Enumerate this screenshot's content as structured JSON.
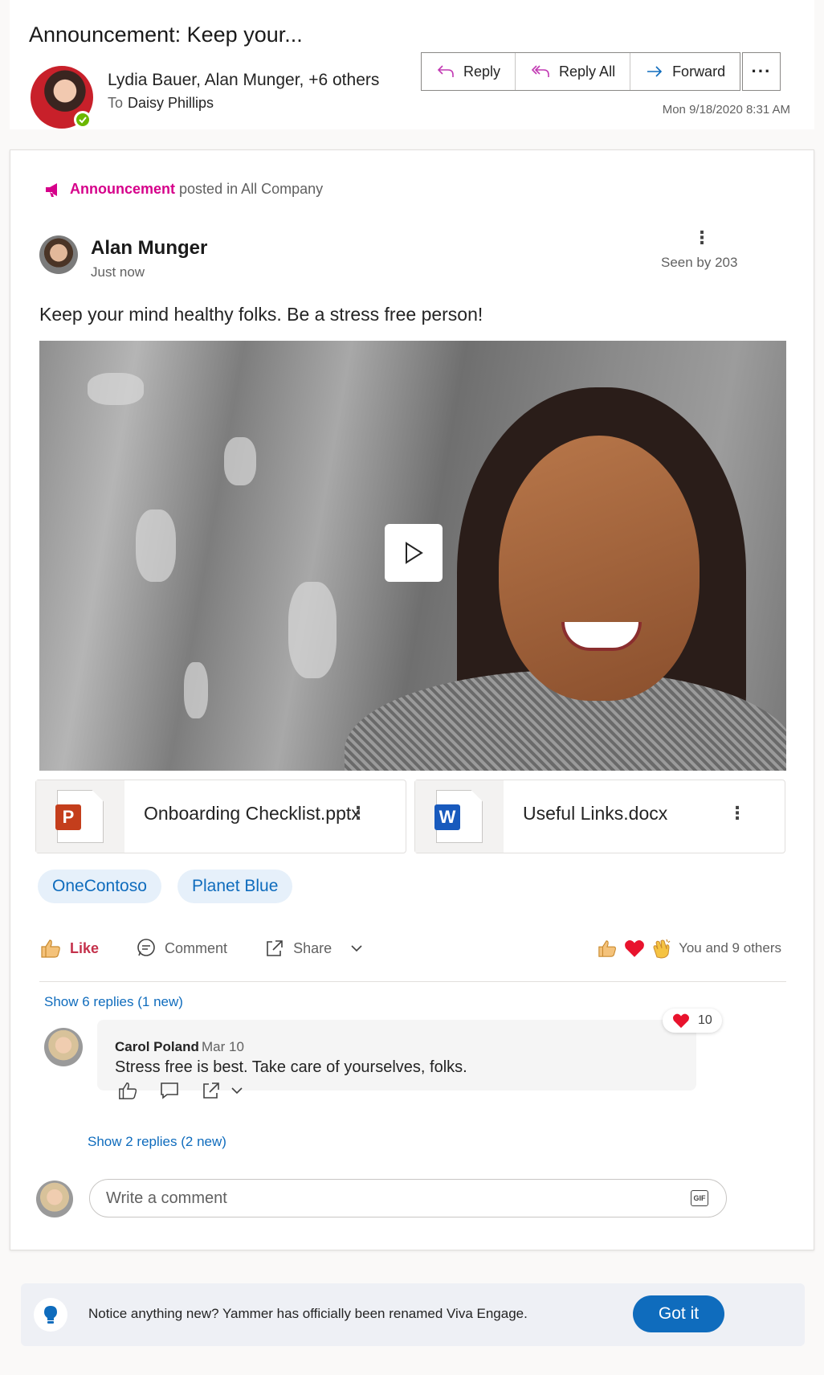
{
  "header": {
    "subject": "Announcement: Keep your...",
    "senders": "Lydia Bauer, Alan Munger, +6 others",
    "to_label": "To",
    "to_name": "Daisy Phillips",
    "date": "Mon 9/18/2020 8:31 AM",
    "actions": {
      "reply": "Reply",
      "reply_all": "Reply All",
      "forward": "Forward"
    }
  },
  "post": {
    "type_label": "Announcement",
    "posted_in": "posted in All Company",
    "author": "Alan Munger",
    "time": "Just now",
    "seen_by": "Seen by 203",
    "text": "Keep your mind healthy folks. Be a stress free person!",
    "attachments": [
      {
        "name": "Onboarding Checklist.pptx",
        "kind": "P"
      },
      {
        "name": "Useful Links.docx",
        "kind": "W"
      }
    ],
    "topics": [
      "OneContoso",
      "Planet Blue"
    ],
    "actions": {
      "like": "Like",
      "comment": "Comment",
      "share": "Share"
    },
    "reaction_summary": "You and 9 others",
    "show_replies": "Show 6 replies (1 new)"
  },
  "comment": {
    "author": "Carol Poland",
    "date": "Mar 10",
    "text": "Stress free is best. Take care of yourselves, folks.",
    "heart_count": "10",
    "show_replies": "Show 2 replies (2 new)"
  },
  "composer": {
    "placeholder": "Write a comment",
    "gif_label": "GIF"
  },
  "notice": {
    "text": "Notice anything new? Yammer has officially been renamed Viva Engage.",
    "button": "Got it"
  },
  "colors": {
    "accent": "#0f6cbd",
    "announcement": "#d6008a",
    "like": "#c4314b",
    "presence": "#6bb700"
  }
}
